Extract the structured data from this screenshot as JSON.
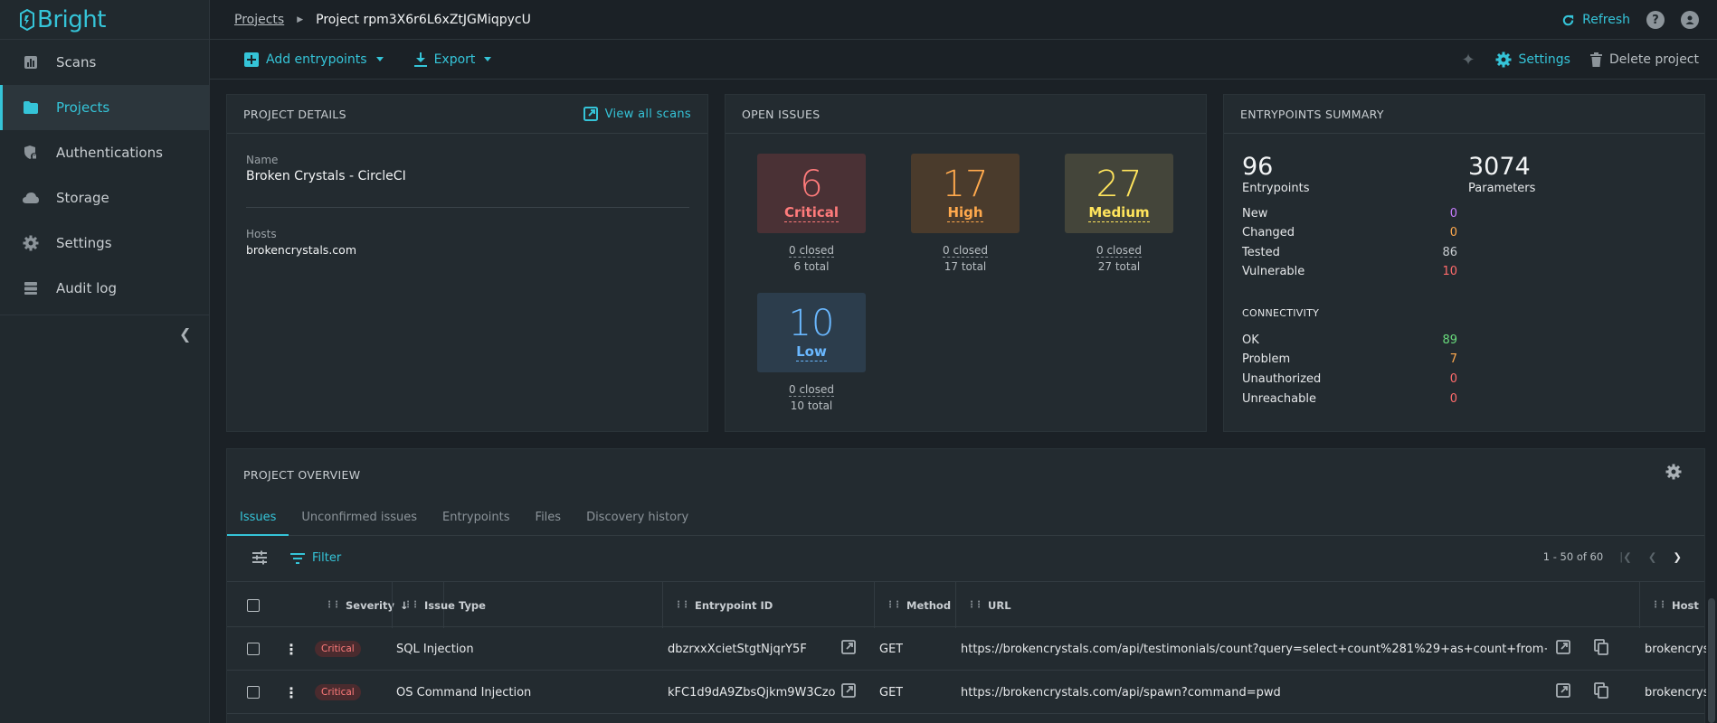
{
  "app": {
    "logo_text": "Bright"
  },
  "sidebar": {
    "items": [
      {
        "label": "Scans",
        "icon": "bar-chart-icon"
      },
      {
        "label": "Projects",
        "icon": "folder-icon",
        "active": true
      },
      {
        "label": "Authentications",
        "icon": "shield-lock-icon"
      },
      {
        "label": "Storage",
        "icon": "cloud-icon"
      },
      {
        "label": "Settings",
        "icon": "gear-icon"
      },
      {
        "label": "Audit log",
        "icon": "list-icon"
      }
    ]
  },
  "header": {
    "breadcrumb_link": "Projects",
    "breadcrumb_current": "Project rpm3X6r6L6xZtJGMiqpycU",
    "refresh_label": "Refresh"
  },
  "toolbar": {
    "add_entrypoints_label": "Add entrypoints",
    "export_label": "Export",
    "settings_label": "Settings",
    "delete_label": "Delete project"
  },
  "project_details": {
    "title": "PROJECT DETAILS",
    "view_all_label": "View all scans",
    "name_label": "Name",
    "name_value": "Broken Crystals - CircleCI",
    "hosts_label": "Hosts",
    "hosts_value": "brokencrystals.com"
  },
  "open_issues": {
    "title": "OPEN ISSUES",
    "severities": [
      {
        "count": "6",
        "name": "Critical",
        "closed": "0 closed",
        "total": "6 total",
        "color": "#ff7b7b",
        "bg": "#4a3135"
      },
      {
        "count": "17",
        "name": "High",
        "closed": "0 closed",
        "total": "17 total",
        "color": "#ffa94d",
        "bg": "#4a3b2c"
      },
      {
        "count": "27",
        "name": "Medium",
        "closed": "0 closed",
        "total": "27 total",
        "color": "#ffe45c",
        "bg": "#44453a"
      },
      {
        "count": "10",
        "name": "Low",
        "closed": "0 closed",
        "total": "10 total",
        "color": "#6ab8ff",
        "bg": "#2c3d4c"
      }
    ]
  },
  "entrypoints_summary": {
    "title": "ENTRYPOINTS SUMMARY",
    "entrypoints_count": "96",
    "entrypoints_label": "Entrypoints",
    "parameters_count": "3074",
    "parameters_label": "Parameters",
    "stats": [
      {
        "label": "New",
        "value": "0",
        "color": "#c77dff"
      },
      {
        "label": "Changed",
        "value": "0",
        "color": "#ffa94d"
      },
      {
        "label": "Tested",
        "value": "86",
        "color": "#c9ced2"
      },
      {
        "label": "Vulnerable",
        "value": "10",
        "color": "#ff6b6b"
      }
    ],
    "connectivity_label": "CONNECTIVITY",
    "connectivity": [
      {
        "label": "OK",
        "value": "89",
        "color": "#69db7c"
      },
      {
        "label": "Problem",
        "value": "7",
        "color": "#ffa94d"
      },
      {
        "label": "Unauthorized",
        "value": "0",
        "color": "#ff6b6b"
      },
      {
        "label": "Unreachable",
        "value": "0",
        "color": "#ff6b6b"
      }
    ]
  },
  "overview": {
    "title": "PROJECT OVERVIEW",
    "tabs": [
      "Issues",
      "Unconfirmed issues",
      "Entrypoints",
      "Files",
      "Discovery history"
    ],
    "filter_label": "Filter",
    "pagination": "1 - 50 of 60",
    "columns": [
      "Severity",
      "Issue Type",
      "Entrypoint ID",
      "Method",
      "URL",
      "Host"
    ],
    "rows": [
      {
        "severity": "Critical",
        "issue_type": "SQL Injection",
        "entrypoint_id": "dbzrxxXcietStgtNjqrY5F",
        "method": "GET",
        "url": "https://brokencrystals.com/api/testimonials/count?query=select+count%281%29+as+count+from+testimo...",
        "host": "brokencrystals.com"
      },
      {
        "severity": "Critical",
        "issue_type": "OS Command Injection",
        "entrypoint_id": "kFC1d9dA9ZbsQjkm9W3Czo",
        "method": "GET",
        "url": "https://brokencrystals.com/api/spawn?command=pwd",
        "host": "brokencrystals.com"
      }
    ]
  }
}
